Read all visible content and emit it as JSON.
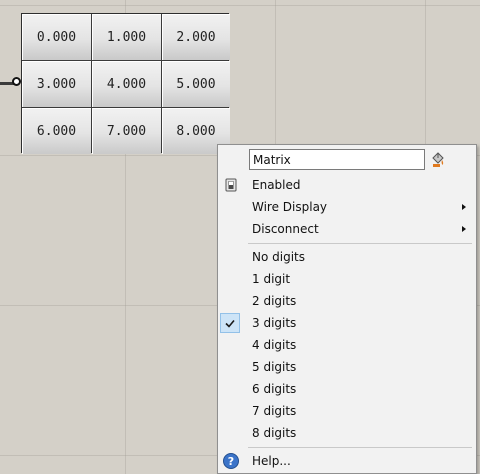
{
  "matrix": {
    "rows": [
      [
        "0.000",
        "1.000",
        "2.000"
      ],
      [
        "3.000",
        "4.000",
        "5.000"
      ],
      [
        "6.000",
        "7.000",
        "8.000"
      ]
    ]
  },
  "menu": {
    "name_value": "Matrix",
    "items": {
      "enabled": "Enabled",
      "wire_display": "Wire Display",
      "disconnect": "Disconnect",
      "no_digits": "No digits",
      "d1": "1 digit",
      "d2": "2 digits",
      "d3": "3 digits",
      "d4": "4 digits",
      "d5": "5 digits",
      "d6": "6 digits",
      "d7": "7 digits",
      "d8": "8 digits",
      "help": "Help..."
    },
    "checked_item": "3 digits",
    "icons": {
      "name_row": "paint-bucket-icon",
      "enabled": "enabled-switch-icon",
      "checked": "checkmark-icon",
      "help": "help-icon"
    }
  },
  "colors": {
    "canvas": "#d4d0c8",
    "menu_bg": "#f2f2f2",
    "check_highlight": "#cde4f7",
    "help_blue": "#3b74c9"
  }
}
